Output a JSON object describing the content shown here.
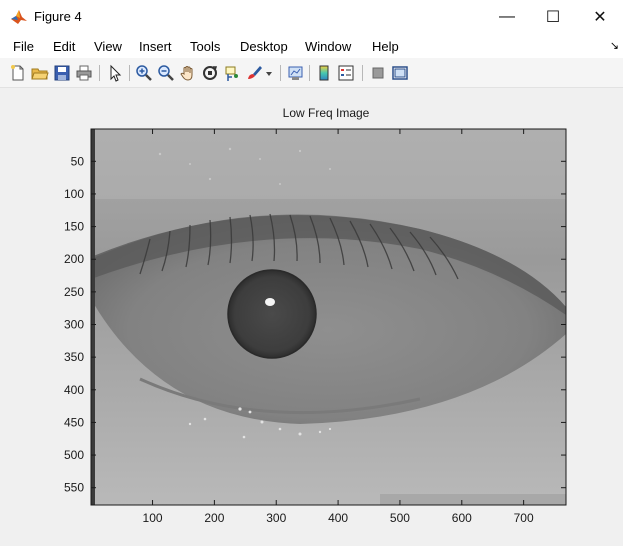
{
  "window": {
    "title": "Figure 4",
    "controls": {
      "minimize": "—",
      "maximize": "☐",
      "close": "✕"
    }
  },
  "menu": {
    "items": [
      "File",
      "Edit",
      "View",
      "Insert",
      "Tools",
      "Desktop",
      "Window",
      "Help"
    ],
    "overflow_arrow": "↘"
  },
  "toolbar": {
    "icons": [
      "new-figure-icon",
      "open-file-icon",
      "save-icon",
      "print-icon",
      "pointer-icon",
      "zoom-in-icon",
      "zoom-out-icon",
      "pan-hand-icon",
      "rotate-3d-icon",
      "data-cursor-icon",
      "brush-icon",
      "dropdown-arrow-icon",
      "link-plot-icon",
      "colorbar-icon",
      "legend-icon",
      "hide-plot-tools-icon",
      "show-plot-tools-icon"
    ]
  },
  "axes": {
    "title": "Low Freq Image",
    "x_ticks": [
      "100",
      "200",
      "300",
      "400",
      "500",
      "600",
      "700"
    ],
    "y_ticks": [
      "50",
      "100",
      "150",
      "200",
      "250",
      "300",
      "350",
      "400",
      "450",
      "500",
      "550"
    ],
    "x_range": [
      0.5,
      768.5
    ],
    "y_range": [
      0.5,
      576.5
    ]
  },
  "colors": {
    "figure_bg": "#f0f0f0",
    "titlebar_bg": "#ffffff",
    "axes_frame": "#1a1a1a"
  }
}
